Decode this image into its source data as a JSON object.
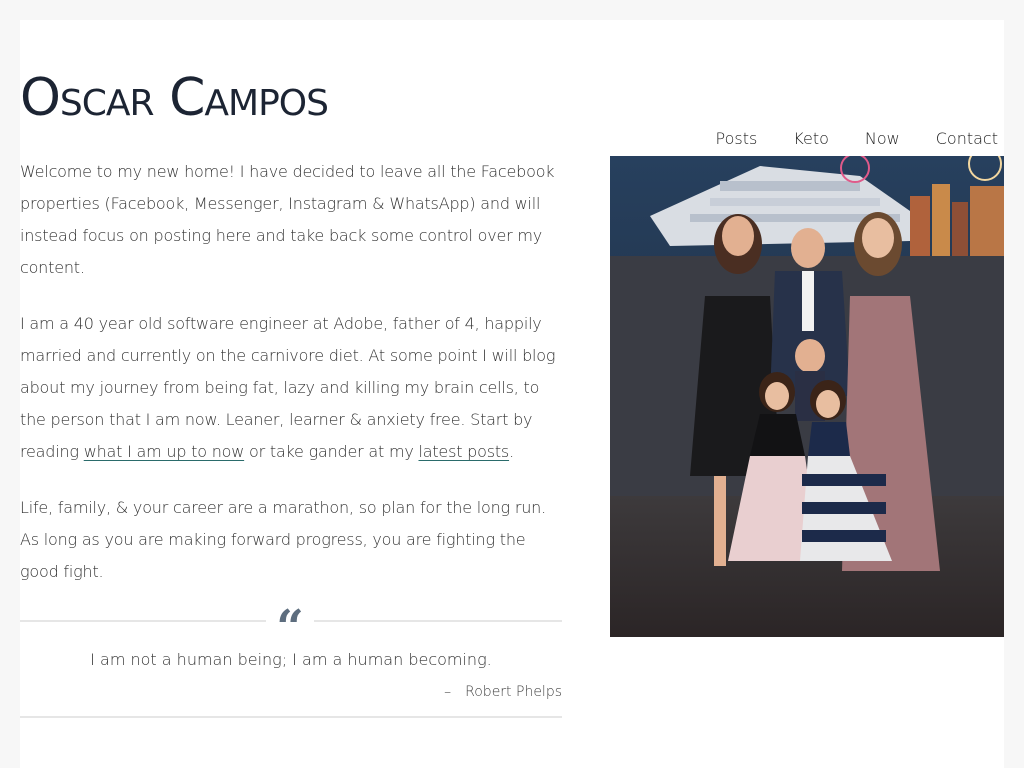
{
  "site": {
    "title": "Oscar Campos"
  },
  "nav": {
    "items": [
      {
        "label": "Posts"
      },
      {
        "label": "Keto"
      },
      {
        "label": "Now"
      },
      {
        "label": "Contact"
      }
    ]
  },
  "intro": {
    "p1": "Welcome to my new home! I have decided to leave all the Facebook properties (Facebook, Messenger, Instagram & WhatsApp) and will instead focus on posting here and take back some control over my content.",
    "p2_before": "I am a 40 year old software engineer at Adobe, father of 4, happily married and currently on the carnivore diet. At some point I will blog about my journey from being fat, lazy and killing my brain cells, to the person that I am now. Leaner, learner & anxiety free. Start by reading ",
    "p2_link1": "what I am up to now",
    "p2_middle": " or take gander at my ",
    "p2_link2": "latest posts",
    "p2_after": ".",
    "p3": "Life, family, & your career are a marathon, so plan for the long run. As long as you are making forward progress, you are fighting the good fight."
  },
  "quote": {
    "mark": "“",
    "text": "I am not a human being; I am a human becoming.",
    "dash": "–",
    "author": "Robert Phelps"
  },
  "colors": {
    "title": "#1c2433",
    "quote_mark": "#5d6d7e",
    "link_underline": "#2a6b6b",
    "page_bg": "#f7f7f7"
  },
  "icons": {
    "quote": "quote-icon"
  }
}
